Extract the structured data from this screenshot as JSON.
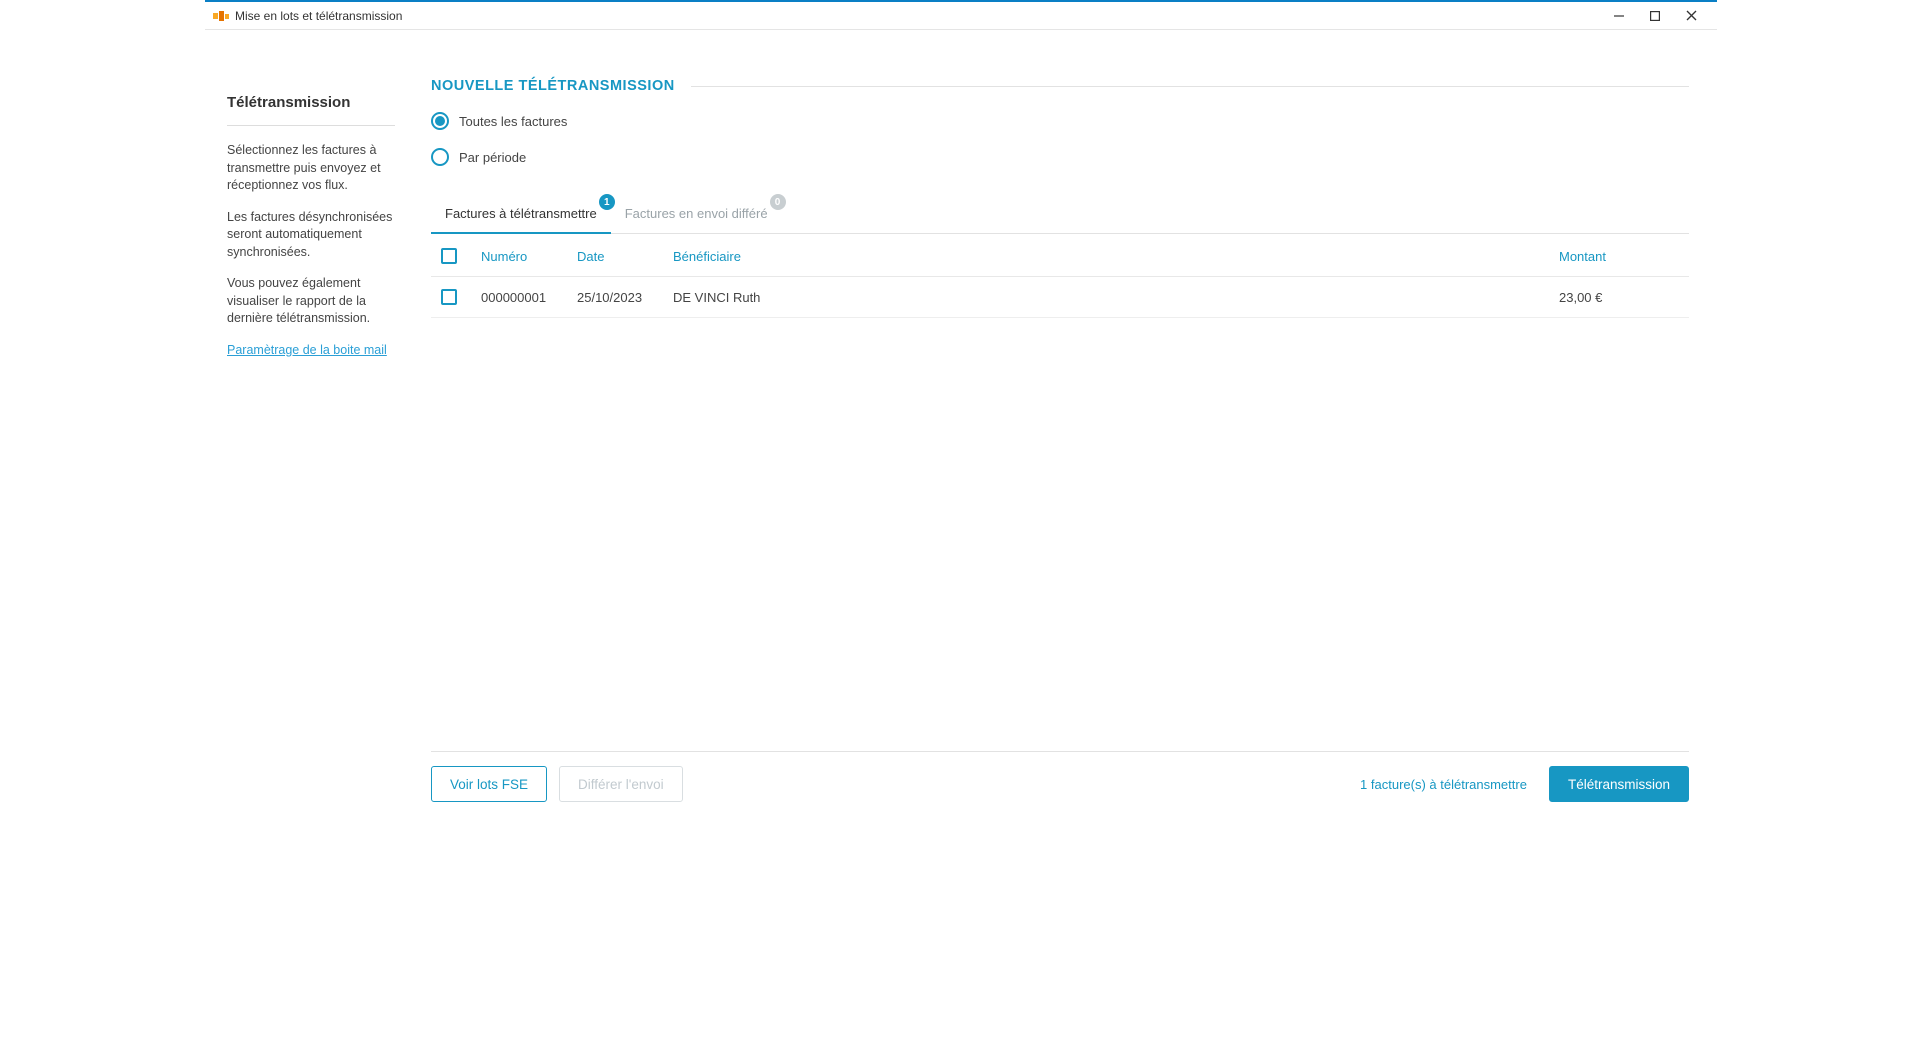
{
  "window": {
    "title": "Mise en lots et télétransmission"
  },
  "sidebar": {
    "title": "Télétransmission",
    "p1": "Sélectionnez les factures à transmettre puis envoyez et réceptionnez vos flux.",
    "p2": "Les factures désynchronisées seront automatiquement synchronisées.",
    "p3": "Vous pouvez également visualiser le rapport de la dernière télétransmission.",
    "link": "Paramètrage de la boite mail"
  },
  "main": {
    "heading": "NOUVELLE TÉLÉTRANSMISSION",
    "radio_all": "Toutes les factures",
    "radio_period": "Par période",
    "tabs": {
      "to_send": {
        "label": "Factures à télétransmettre",
        "badge": "1"
      },
      "deferred": {
        "label": "Factures en envoi différé",
        "badge": "0"
      }
    },
    "columns": {
      "numero": "Numéro",
      "date": "Date",
      "beneficiaire": "Bénéficiaire",
      "montant": "Montant"
    },
    "rows": [
      {
        "numero": "000000001",
        "date": "25/10/2023",
        "beneficiaire": "DE VINCI Ruth",
        "montant": "23,00 €"
      }
    ]
  },
  "footer": {
    "voir_lots": "Voir lots FSE",
    "differer": "Différer l'envoi",
    "status": "1 facture(s) à télétransmettre",
    "teletransmission": "Télétransmission"
  }
}
